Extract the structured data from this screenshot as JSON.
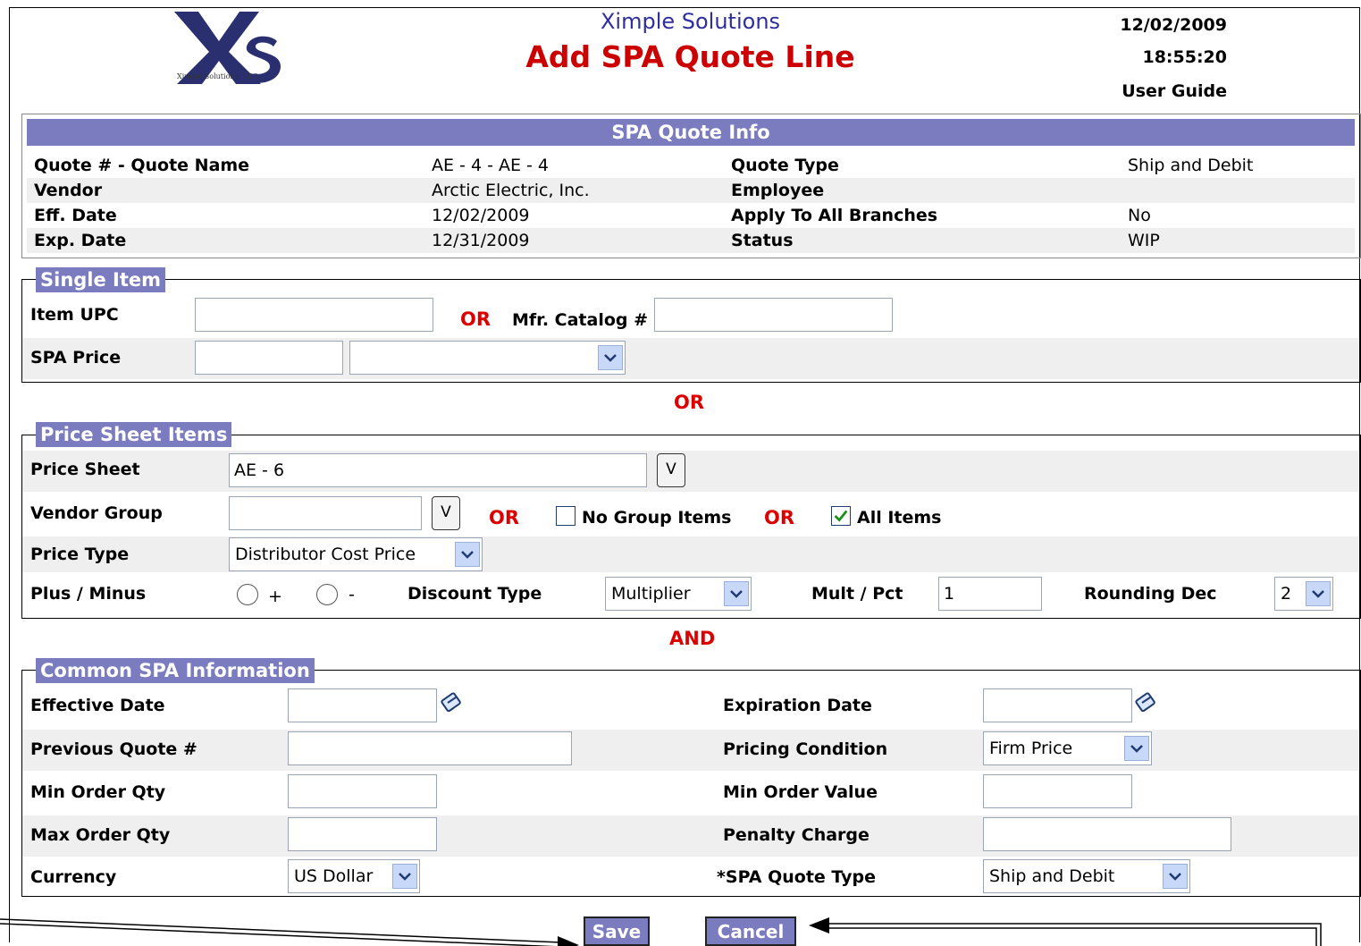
{
  "header": {
    "logo_text": "Ximple Solutions, LLC",
    "company": "Ximple Solutions",
    "title": "Add SPA Quote Line",
    "date": "12/02/2009",
    "time": "18:55:20",
    "user_guide": "User Guide"
  },
  "quote_info": {
    "heading": "SPA Quote Info",
    "rows": [
      {
        "l1": "Quote # - Quote Name",
        "v1": "AE - 4 - AE - 4",
        "l2": "Quote Type",
        "v2": "Ship and Debit"
      },
      {
        "l1": "Vendor",
        "v1": "Arctic Electric, Inc.",
        "l2": "Employee",
        "v2": ""
      },
      {
        "l1": "Eff. Date",
        "v1": "12/02/2009",
        "l2": "Apply To All Branches",
        "v2": "No"
      },
      {
        "l1": "Exp. Date",
        "v1": "12/31/2009",
        "l2": "Status",
        "v2": "WIP"
      }
    ]
  },
  "single_item": {
    "legend": "Single Item",
    "item_upc_label": "Item UPC",
    "or": "OR",
    "mfr_catalog_label": "Mfr. Catalog #",
    "spa_price_label": "SPA Price",
    "spa_price_value": "",
    "spa_price_unit": ""
  },
  "or_between": "OR",
  "price_sheet": {
    "legend": "Price Sheet Items",
    "price_sheet_label": "Price Sheet",
    "price_sheet_value": "AE - 6",
    "v_label": "V",
    "vendor_group_label": "Vendor Group",
    "or": "OR",
    "no_group_label": "No Group Items",
    "all_items_label": "All Items",
    "all_items_checked": true,
    "price_type_label": "Price Type",
    "price_type_value": "Distributor Cost Price",
    "plus_minus_label": "Plus / Minus",
    "plus": "+",
    "minus": "-",
    "discount_type_label": "Discount Type",
    "discount_type_value": "Multiplier",
    "mult_pct_label": "Mult / Pct",
    "mult_pct_value": "1",
    "rounding_label": "Rounding Dec",
    "rounding_value": "2"
  },
  "and_between": "AND",
  "common": {
    "legend": "Common SPA Information",
    "effective_date_label": "Effective Date",
    "expiration_date_label": "Expiration Date",
    "previous_quote_label": "Previous Quote #",
    "pricing_condition_label": "Pricing Condition",
    "pricing_condition_value": "Firm Price",
    "min_order_qty_label": "Min Order Qty",
    "min_order_value_label": "Min Order Value",
    "max_order_qty_label": "Max Order Qty",
    "penalty_charge_label": "Penalty Charge",
    "currency_label": "Currency",
    "currency_value": "US Dollar",
    "spa_quote_type_label": "*SPA Quote Type",
    "spa_quote_type_value": "Ship and Debit"
  },
  "buttons": {
    "save": "Save",
    "cancel": "Cancel"
  },
  "colors": {
    "accent": "#7b7bc0",
    "title_red": "#cc0000",
    "or_red": "#dd0000",
    "company_blue": "#2e2e9e"
  }
}
